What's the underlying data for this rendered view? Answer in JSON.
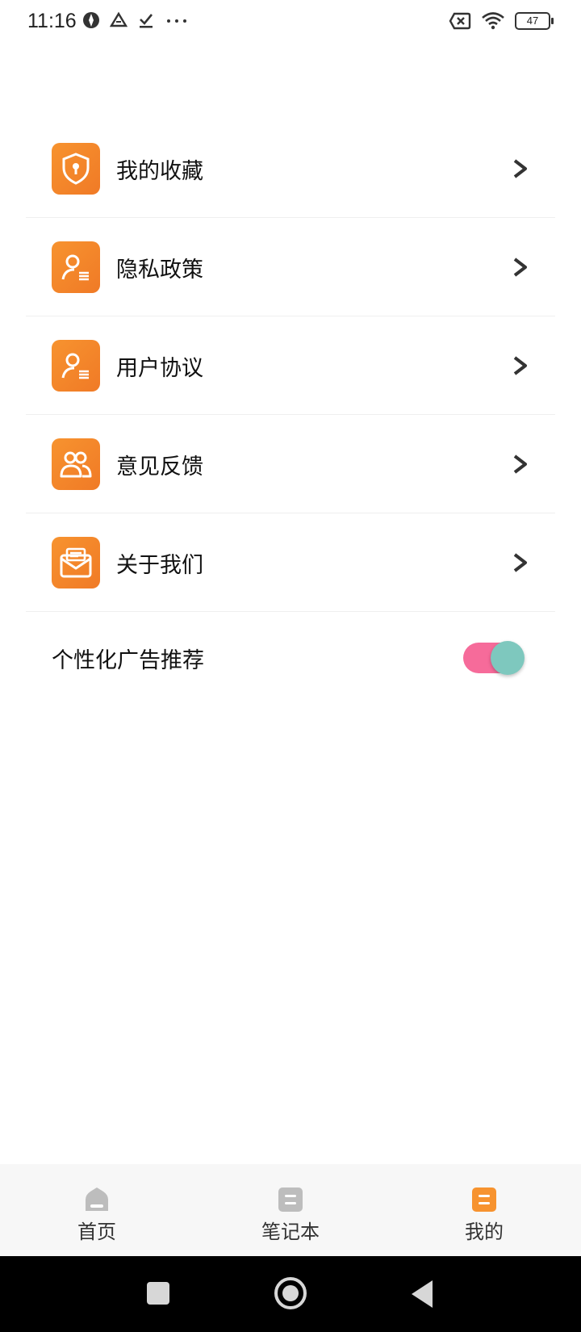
{
  "status_bar": {
    "time": "11:16",
    "battery": "47",
    "left_icons": [
      "vpn-icon",
      "drive-icon",
      "download-done-icon",
      "more-dots-icon"
    ],
    "right_icons": [
      "sim-off-icon",
      "wifi-icon",
      "battery-icon"
    ]
  },
  "menu": {
    "items": [
      {
        "label": "我的收藏",
        "icon": "shield-lock-icon"
      },
      {
        "label": "隐私政策",
        "icon": "user-list-icon"
      },
      {
        "label": "用户协议",
        "icon": "user-list-icon"
      },
      {
        "label": "意见反馈",
        "icon": "users-group-icon"
      },
      {
        "label": "关于我们",
        "icon": "mail-open-icon"
      }
    ]
  },
  "settings": {
    "ad_personalization": {
      "label": "个性化广告推荐",
      "enabled": true
    }
  },
  "tab_bar": {
    "tabs": [
      {
        "label": "首页",
        "icon": "home-icon",
        "active": false
      },
      {
        "label": "笔记本",
        "icon": "notebook-icon",
        "active": false
      },
      {
        "label": "我的",
        "icon": "profile-icon",
        "active": true
      }
    ]
  },
  "colors": {
    "accent": "#F7932F",
    "toggle_track": "#F66B9A",
    "toggle_knob": "#7EC8BE",
    "inactive_tab": "#BDBDBD"
  }
}
